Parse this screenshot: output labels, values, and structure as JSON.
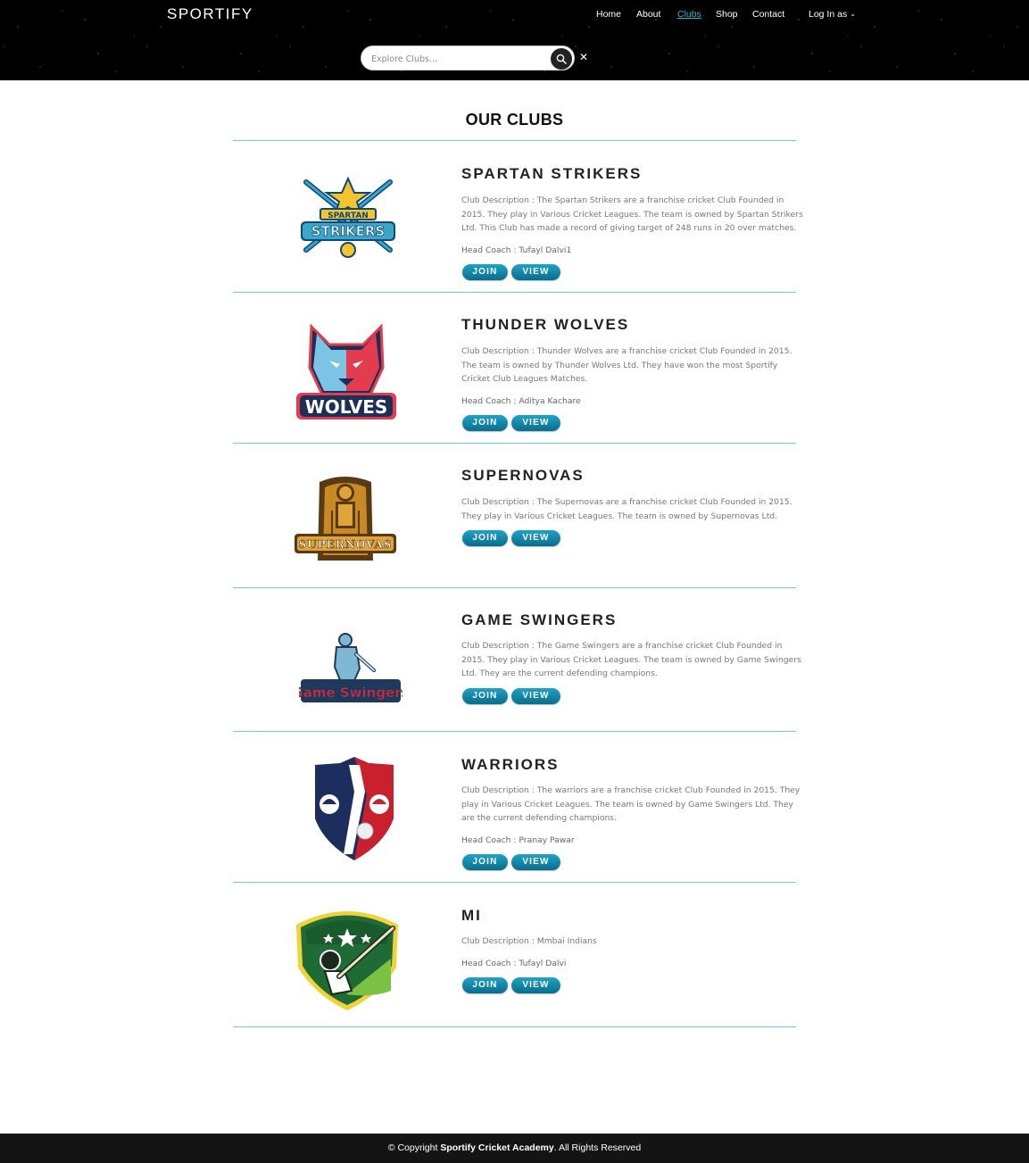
{
  "brand": "SPORTIFY",
  "nav": {
    "items": [
      {
        "label": "Home"
      },
      {
        "label": "About"
      },
      {
        "label": "Clubs"
      },
      {
        "label": "Shop"
      },
      {
        "label": "Contact"
      }
    ],
    "login_label": "Log In as",
    "active": "Clubs"
  },
  "search": {
    "placeholder": "Explore Clubs...",
    "value": ""
  },
  "page_title": "OUR CLUBS",
  "clubs": [
    {
      "name": "SPARTAN STRIKERS",
      "description": "Club Description : The Spartan Strikers are a franchise cricket Club Founded in 2015. They play in Various Cricket Leagues. The team is owned by Spartan Strikers Ltd. This Club has made a record of giving target of 248 runs in 20 over matches.",
      "coach": "Head Coach : Tufayl Dalvi1",
      "logo_icon": "spartan-strikers-logo",
      "join_label": "JOIN",
      "view_label": "VIEW"
    },
    {
      "name": "THUNDER WOLVES",
      "description": "Club Description : Thunder Wolves are a franchise cricket Club Founded in 2015. The team is owned by Thunder Wolves Ltd. They have won the most Sportify Cricket Club Leagues Matches.",
      "coach": "Head Coach : Aditya Kachare",
      "logo_icon": "wolves-logo",
      "join_label": "JOIN",
      "view_label": "VIEW"
    },
    {
      "name": "SUPERNOVAS",
      "description": "Club Description : The Supernovas are a franchise cricket Club Founded in 2015. They play in Various Cricket Leagues. The team is owned by Supernovas Ltd.",
      "coach": "",
      "logo_icon": "supernovas-logo",
      "join_label": "JOIN",
      "view_label": "VIEW"
    },
    {
      "name": "GAME SWINGERS",
      "description": "Club Description : The Game Swingers are a franchise cricket Club Founded in 2015. They play in Various Cricket Leagues. The team is owned by Game Swingers Ltd. They are the current defending champions.",
      "coach": "",
      "logo_icon": "game-swingers-logo",
      "join_label": "JOIN",
      "view_label": "VIEW"
    },
    {
      "name": "WARRIORS",
      "description": "Club Description : The warriors are a franchise cricket Club Founded in 2015. They play in Various Cricket Leagues. The team is owned by Game Swingers Ltd. They are the current defending champions.",
      "coach": "Head Coach : Pranay Pawar",
      "logo_icon": "warriors-shield-logo",
      "join_label": "JOIN",
      "view_label": "VIEW"
    },
    {
      "name": "MI",
      "description": "Club Description : Mmbai Indians",
      "coach": "Head Coach : Tufayl Dalvi",
      "logo_icon": "mi-batsman-logo",
      "join_label": "JOIN",
      "view_label": "VIEW"
    }
  ],
  "footer": {
    "prefix": "© Copyright ",
    "org": "Sportify Cricket Academy",
    "suffix": ". All Rights Reserved"
  },
  "colors": {
    "accent": "#2fb5d8",
    "button": "#1289ab",
    "divider": "#6fcde3",
    "header_bg": "#000000",
    "footer_bg": "#141414"
  }
}
